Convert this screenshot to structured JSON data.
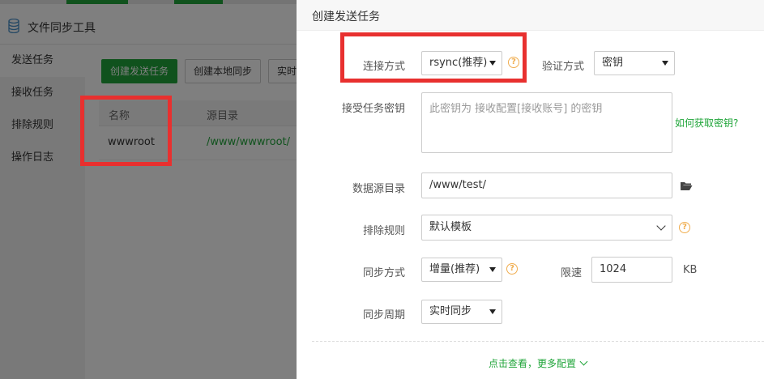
{
  "app": {
    "title": "文件同步工具",
    "sidebar": [
      "发送任务",
      "接收任务",
      "排除规则",
      "操作日志"
    ],
    "toolbar": {
      "create_send": "创建发送任务",
      "create_local": "创建本地同步",
      "realtime": "实时"
    },
    "table": {
      "headers": [
        "名称",
        "源目录"
      ],
      "rows": [
        {
          "name": "wwwroot",
          "source": "/www/wwwroot/"
        }
      ]
    }
  },
  "drawer": {
    "title": "创建发送任务",
    "connection": {
      "label": "连接方式",
      "value": "rsync(推荐)"
    },
    "auth": {
      "label": "验证方式",
      "value": "密钥"
    },
    "key": {
      "label": "接受任务密钥",
      "placeholder": "此密钥为 接收配置[接收账号] 的密钥",
      "help_link": "如何获取密钥?"
    },
    "source_dir": {
      "label": "数据源目录",
      "value": "/www/test/"
    },
    "exclude": {
      "label": "排除规则",
      "value": "默认模板"
    },
    "sync_mode": {
      "label": "同步方式",
      "value": "增量(推荐)"
    },
    "speed_limit": {
      "label": "限速",
      "value": "1024",
      "unit": "KB"
    },
    "sync_period": {
      "label": "同步周期",
      "value": "实时同步"
    },
    "more_config": "点击查看，更多配置"
  },
  "colors": {
    "accent": "#20a53a",
    "annotation_red": "#e8302f",
    "help_orange": "#f0ad4e"
  }
}
